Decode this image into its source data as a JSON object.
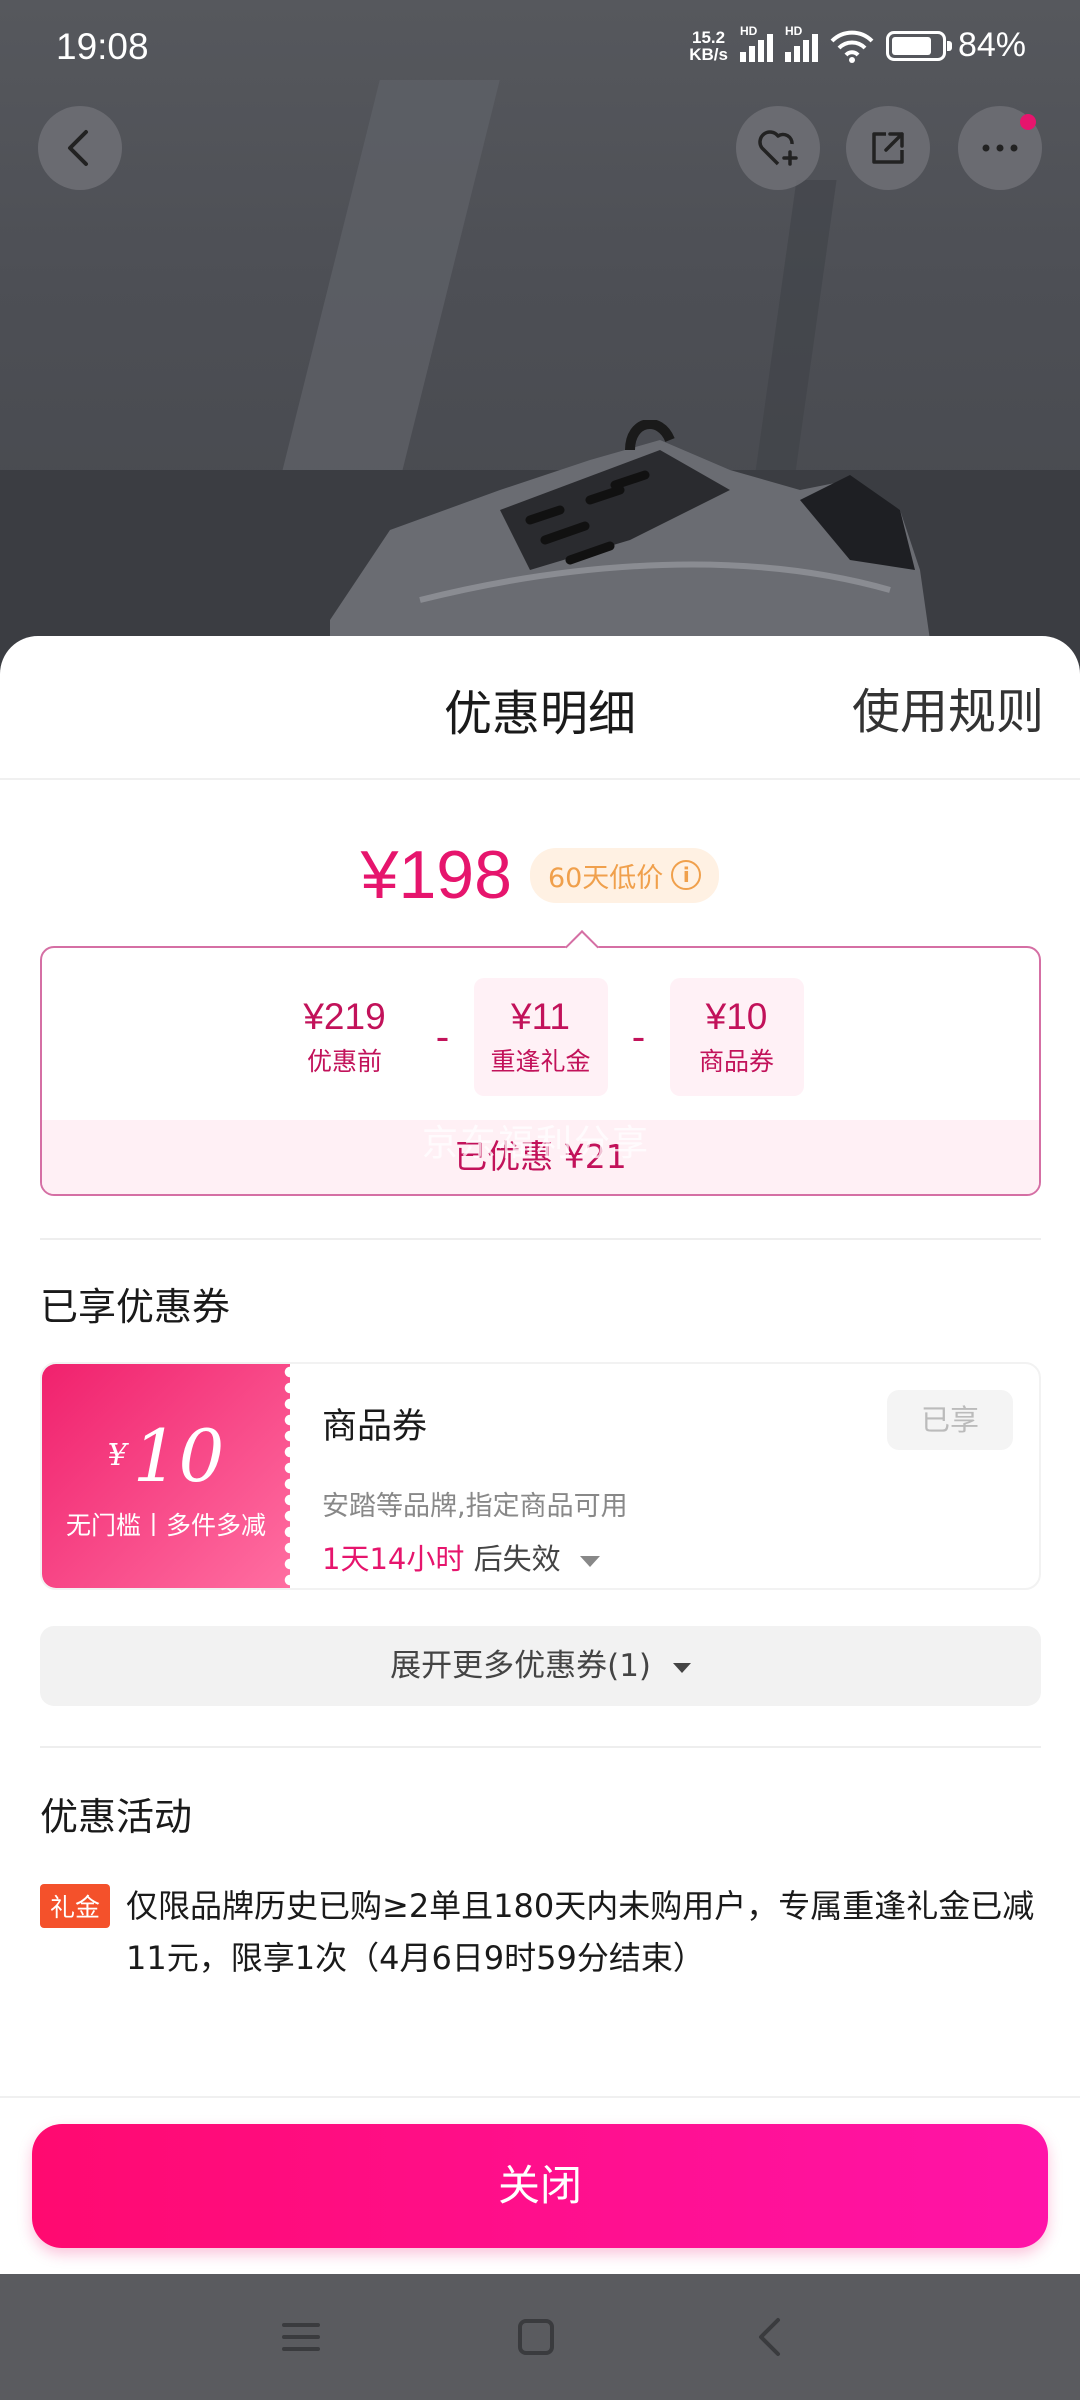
{
  "status_bar": {
    "time": "19:08",
    "net_speed_value": "15.2",
    "net_speed_unit": "KB/s",
    "signal_label": "HD",
    "battery": "84%"
  },
  "sheet": {
    "title": "优惠明细",
    "rules_link": "使用规则"
  },
  "price": {
    "final": "¥198",
    "badge": "60天低价",
    "info_icon_glyph": "i"
  },
  "breakdown": {
    "items": [
      {
        "value": "¥219",
        "label": "优惠前"
      },
      {
        "value": "¥11",
        "label": "重逢礼金"
      },
      {
        "value": "¥10",
        "label": "商品券"
      }
    ],
    "operator": "-",
    "saved": "已优惠 ¥21",
    "watermark": "京东福利分享"
  },
  "coupons_section": {
    "title": "已享优惠券",
    "coupon": {
      "currency": "¥",
      "amount": "10",
      "condition": "无门槛丨多件多减",
      "name": "商品券",
      "description": "安踏等品牌,指定商品可用",
      "expiry_highlight": "1天14小时",
      "expiry_suffix": "后失效",
      "state": "已享"
    },
    "expand_label": "展开更多优惠券(1)"
  },
  "activities_section": {
    "title": "优惠活动",
    "tag": "礼金",
    "text": "仅限品牌历史已购≥2单且180天内未购用户，专属重逢礼金已减11元，限享1次（4月6日9时59分结束）"
  },
  "close_button": "关闭",
  "colors": {
    "accent": "#e6156d",
    "badge_orange": "#f0a04c",
    "tag_red": "#f4512b"
  },
  "icons": [
    "back-icon",
    "favorite-add-icon",
    "share-icon",
    "more-icon",
    "menu-icon",
    "home-icon",
    "nav-back-icon"
  ]
}
